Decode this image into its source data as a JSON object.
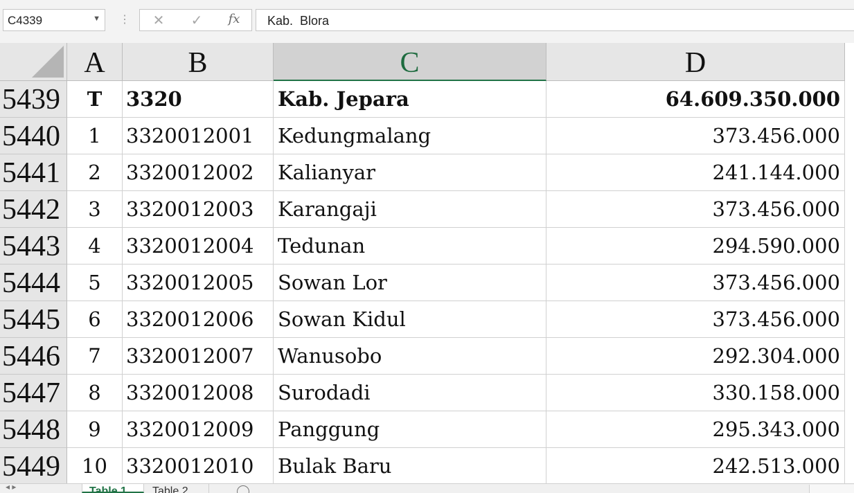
{
  "formula_bar": {
    "name_box": "C4339",
    "formula": "Kab.  Blora",
    "cancel_icon": "✕",
    "enter_icon": "✓",
    "fx_icon": "fx"
  },
  "columns": [
    "A",
    "B",
    "C",
    "D"
  ],
  "selected_column": "C",
  "rows": [
    {
      "row": "5439",
      "a": "T",
      "b": "3320",
      "c": "Kab. Jepara",
      "d": "64.609.350.000",
      "bold": true
    },
    {
      "row": "5440",
      "a": "1",
      "b": "3320012001",
      "c": "Kedungmalang",
      "d": "373.456.000"
    },
    {
      "row": "5441",
      "a": "2",
      "b": "3320012002",
      "c": "Kalianyar",
      "d": "241.144.000"
    },
    {
      "row": "5442",
      "a": "3",
      "b": "3320012003",
      "c": "Karangaji",
      "d": "373.456.000"
    },
    {
      "row": "5443",
      "a": "4",
      "b": "3320012004",
      "c": "Tedunan",
      "d": "294.590.000"
    },
    {
      "row": "5444",
      "a": "5",
      "b": "3320012005",
      "c": "Sowan Lor",
      "d": "373.456.000"
    },
    {
      "row": "5445",
      "a": "6",
      "b": "3320012006",
      "c": "Sowan Kidul",
      "d": "373.456.000"
    },
    {
      "row": "5446",
      "a": "7",
      "b": "3320012007",
      "c": "Wanusobo",
      "d": "292.304.000"
    },
    {
      "row": "5447",
      "a": "8",
      "b": "3320012008",
      "c": "Surodadi",
      "d": "330.158.000"
    },
    {
      "row": "5448",
      "a": "9",
      "b": "3320012009",
      "c": "Panggung",
      "d": "295.343.000"
    },
    {
      "row": "5449",
      "a": "10",
      "b": "3320012010",
      "c": "Bulak Baru",
      "d": "242.513.000"
    }
  ],
  "sheet_tabs": [
    "Table 1",
    "Table 2"
  ],
  "active_tab": "Table 1",
  "colors": {
    "accent": "#217346",
    "header_bg": "#e6e6e6"
  }
}
